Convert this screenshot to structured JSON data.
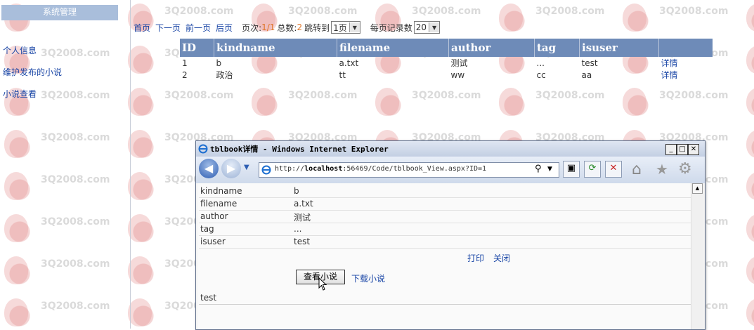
{
  "watermark": {
    "text": "3Q2008.com"
  },
  "sidebar": {
    "header": "系统管理",
    "items": [
      {
        "label": "个人信息"
      },
      {
        "label": "维护发布的小说"
      },
      {
        "label": "小说查看"
      }
    ]
  },
  "pager": {
    "first": "首页",
    "next": "下一页",
    "prev": "前一页",
    "last": "后页",
    "page_label": "页次:",
    "page_value": "1/1",
    "total_label": "总数:",
    "total_value": "2",
    "jump_label": "跳转到",
    "jump_value": "1页",
    "per_page_label": "每页记录数",
    "per_page_value": "20"
  },
  "table": {
    "headers": [
      "ID",
      "kindname",
      "filename",
      "author",
      "tag",
      "isuser",
      ""
    ],
    "rows": [
      {
        "id": "1",
        "kindname": "b",
        "filename": "a.txt",
        "author": "测试",
        "tag": "...",
        "isuser": "test",
        "action": "详情"
      },
      {
        "id": "2",
        "kindname": "政治",
        "filename": "tt",
        "author": "ww",
        "tag": "cc",
        "isuser": "aa",
        "action": "详情"
      }
    ]
  },
  "popup": {
    "title": "tblbook详情 - Windows Internet Explorer",
    "url_prefix": "http://",
    "url_host": "localhost",
    "url_rest": ":56469/Code/tblbook_View.aspx?ID=1",
    "fields": [
      {
        "key": "kindname",
        "value": "b"
      },
      {
        "key": "filename",
        "value": "a.txt"
      },
      {
        "key": "author",
        "value": "测试"
      },
      {
        "key": "tag",
        "value": "..."
      },
      {
        "key": "isuser",
        "value": "test"
      }
    ],
    "print_label": "打印",
    "close_label": "关闭",
    "view_button": "查看小说",
    "download_label": "下载小说",
    "footer_text": "test"
  }
}
